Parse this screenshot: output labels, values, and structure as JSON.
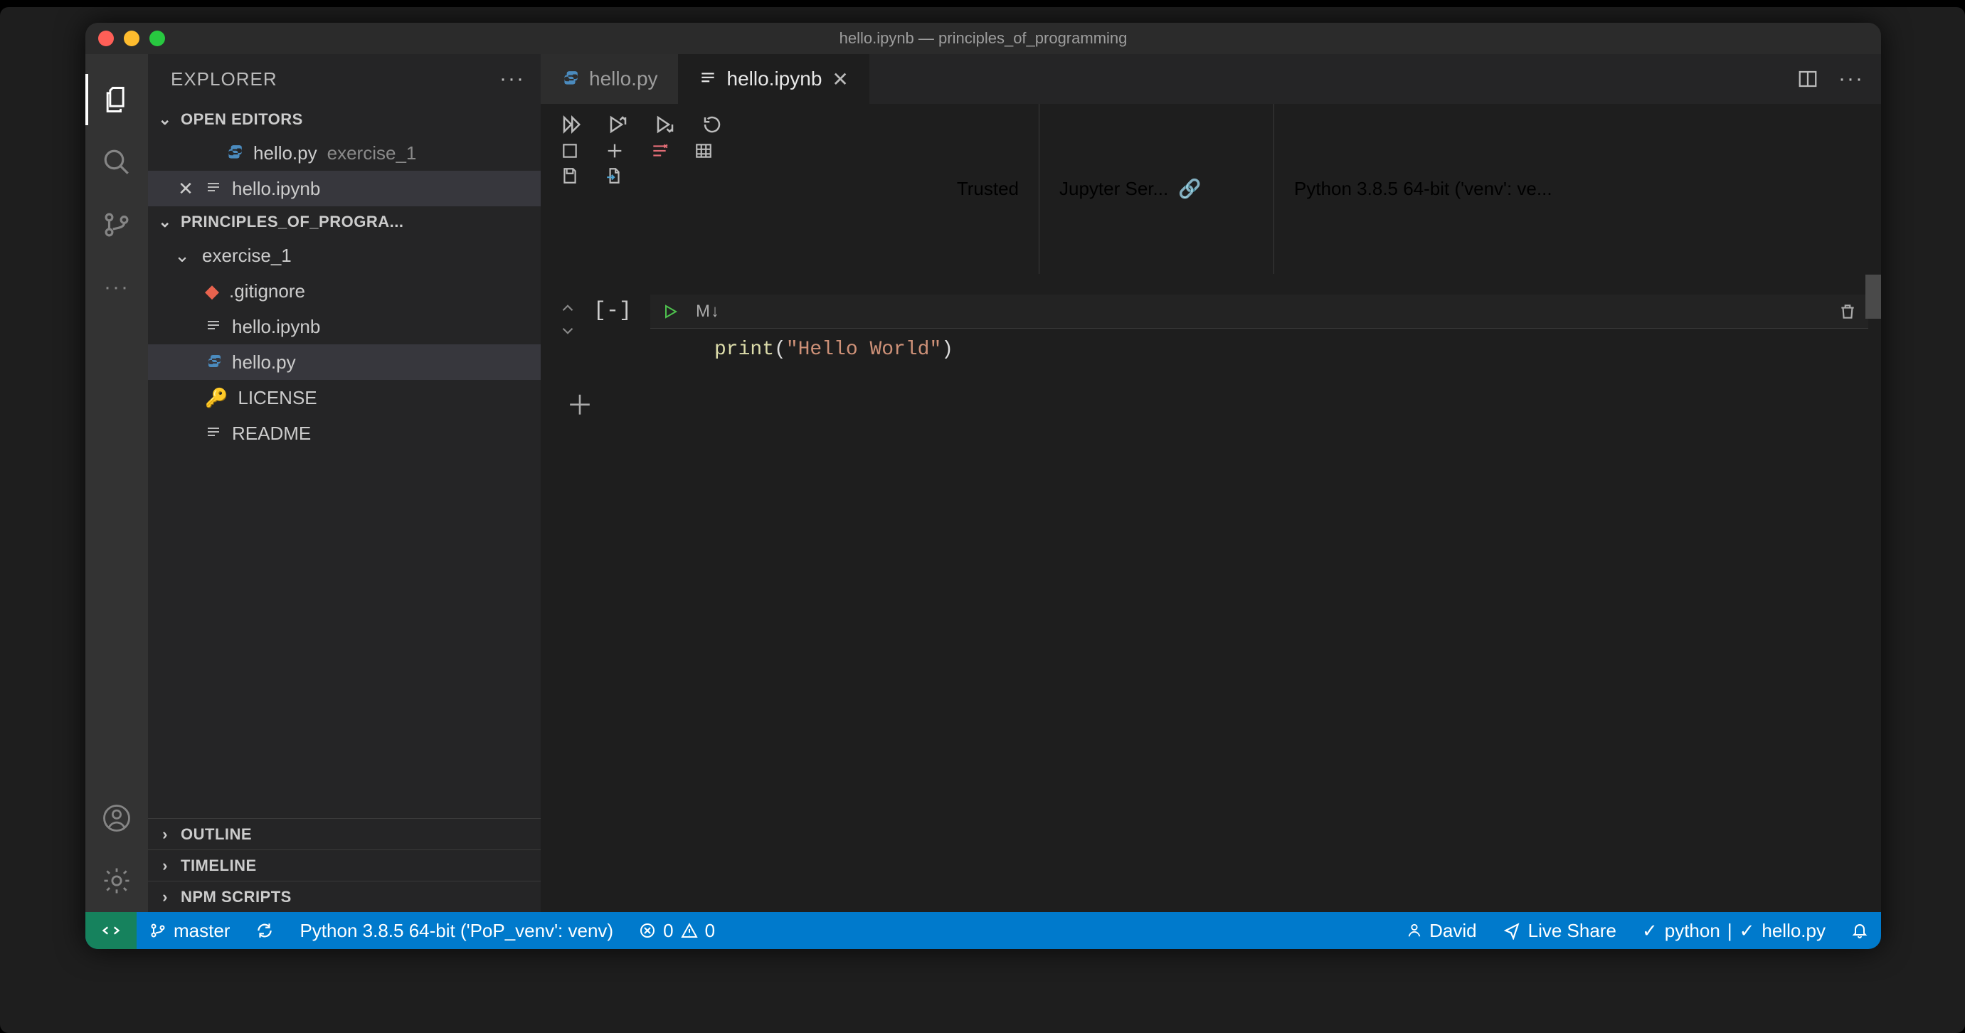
{
  "titlebar": {
    "title": "hello.ipynb — principles_of_programming"
  },
  "sidebar": {
    "header": "EXPLORER",
    "open_editors_label": "OPEN EDITORS",
    "open_editors": [
      {
        "name": "hello.py",
        "detail": "exercise_1",
        "icon": "python"
      },
      {
        "name": "hello.ipynb",
        "detail": "",
        "icon": "notebook",
        "active": true
      }
    ],
    "workspace_label": "PRINCIPLES_OF_PROGRA...",
    "folder": "exercise_1",
    "files": [
      {
        "name": ".gitignore",
        "icon": "git"
      },
      {
        "name": "hello.ipynb",
        "icon": "notebook"
      },
      {
        "name": "hello.py",
        "icon": "python",
        "selected": true
      },
      {
        "name": "LICENSE",
        "icon": "key"
      },
      {
        "name": "README",
        "icon": "text"
      }
    ],
    "panels": [
      "OUTLINE",
      "TIMELINE",
      "NPM SCRIPTS"
    ]
  },
  "tabs": [
    {
      "name": "hello.py",
      "icon": "python",
      "active": false
    },
    {
      "name": "hello.ipynb",
      "icon": "notebook",
      "active": true
    }
  ],
  "notebook": {
    "trusted": "Trusted",
    "server": "Jupyter Ser...",
    "kernel": "Python 3.8.5 64-bit ('venv': ve...",
    "cell": {
      "collapse": "[-]",
      "markdown_btn": "M↓",
      "code_fn": "print",
      "code_open": "(",
      "code_str": "\"Hello World\"",
      "code_close": ")"
    }
  },
  "statusbar": {
    "branch": "master",
    "interpreter": "Python 3.8.5 64-bit ('PoP_venv': venv)",
    "errors": "0",
    "warnings": "0",
    "user": "David",
    "liveshare": "Live Share",
    "lang": "python",
    "file": "hello.py"
  }
}
